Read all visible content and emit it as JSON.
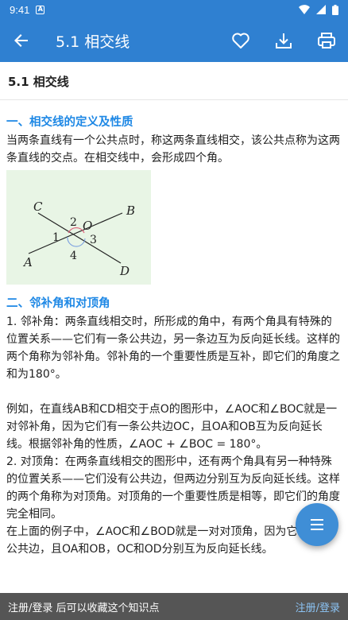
{
  "status_bar": {
    "time": "9:41",
    "notification_glyph": "A"
  },
  "app_bar": {
    "title": "5.1 相交线"
  },
  "page": {
    "heading": "5.1 相交线"
  },
  "sections": [
    {
      "heading": "一、相交线的定义及性质",
      "paragraphs": [
        "当两条直线有一个公共点时，称这两条直线相交，该公共点称为这两条直线的交点。在相交线中，会形成四个角。"
      ]
    },
    {
      "heading": "二、邻补角和对顶角",
      "paragraphs": [
        "1. 邻补角：两条直线相交时，所形成的角中，有两个角具有特殊的位置关系——它们有一条公共边，另一条边互为反向延长线。这样的两个角称为邻补角。邻补角的一个重要性质是互补，即它们的角度之和为180°。",
        "例如，在直线AB和CD相交于点O的图形中，∠AOC和∠BOC就是一对邻补角，因为它们有一条公共边OC，且OA和OB互为反向延长线。根据邻补角的性质，∠AOC + ∠BOC = 180°。",
        "2. 对顶角：在两条直线相交的图形中，还有两个角具有另一种特殊的位置关系——它们没有公共边，但两边分别互为反向延长线。这样的两个角称为对顶角。对顶角的一个重要性质是相等，即它们的角度完全相同。",
        "在上面的例子中，∠AOC和∠BOD就是一对对顶角，因为它们没有公共边，且OA和OB，OC和OD分别互为反向延长线。"
      ]
    }
  ],
  "figure": {
    "labels": {
      "A": "A",
      "B": "B",
      "C": "C",
      "D": "D",
      "O": "O",
      "a1": "1",
      "a2": "2",
      "a3": "3",
      "a4": "4"
    },
    "background": "#e8f5e5"
  },
  "bottom_bar": {
    "message": "注册/登录 后可以收藏这个知识点",
    "link": "注册/登录"
  },
  "colors": {
    "primary": "#2f80d1",
    "heading": "#1e88e5"
  },
  "icons": [
    "arrow-back-icon",
    "heart-icon",
    "download-icon",
    "print-icon",
    "list-icon"
  ]
}
